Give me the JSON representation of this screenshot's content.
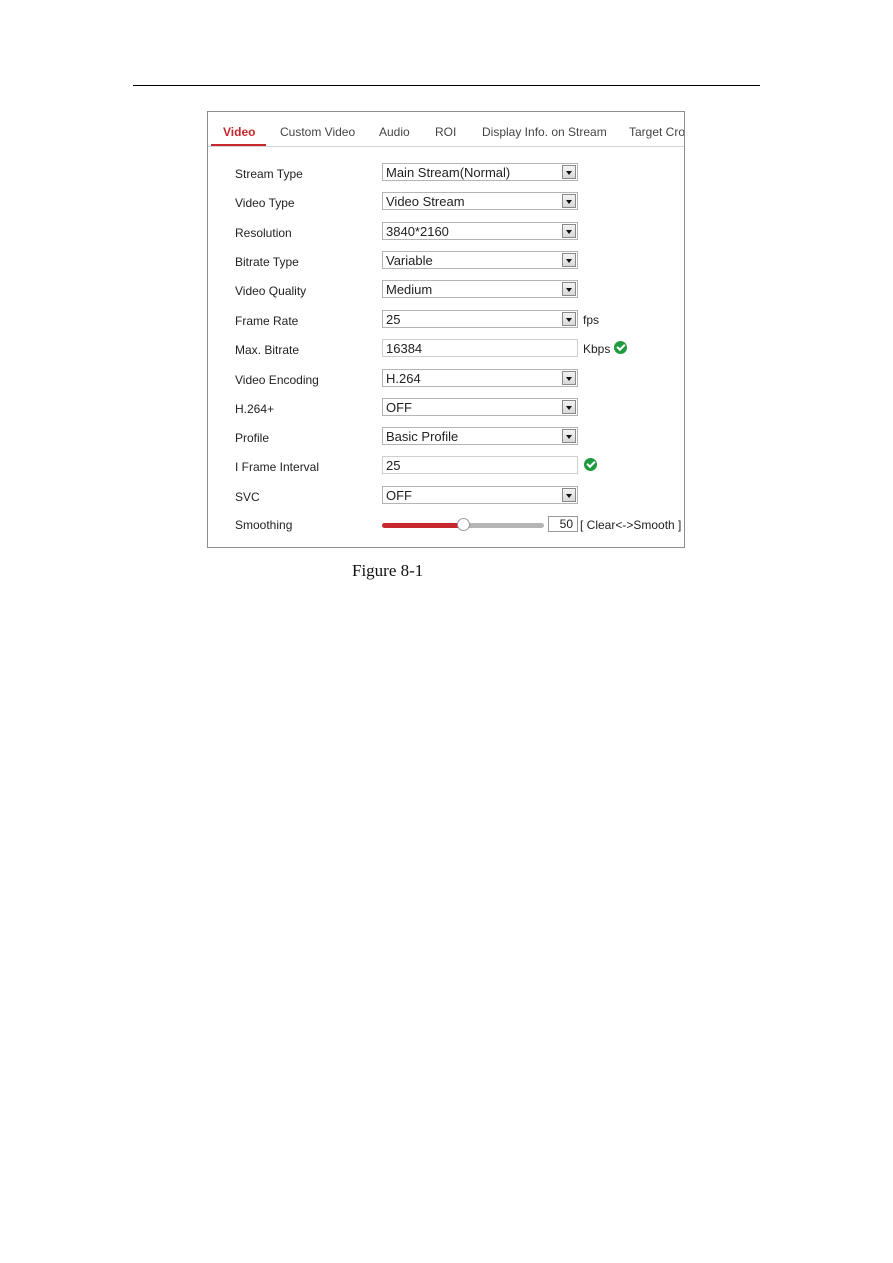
{
  "tabs": [
    {
      "label": "Video",
      "active": true
    },
    {
      "label": "Custom Video",
      "active": false
    },
    {
      "label": "Audio",
      "active": false
    },
    {
      "label": "ROI",
      "active": false
    },
    {
      "label": "Display Info. on Stream",
      "active": false
    },
    {
      "label": "Target Cro",
      "active": false
    }
  ],
  "form": {
    "stream_type": {
      "label": "Stream Type",
      "value": "Main Stream(Normal)"
    },
    "video_type": {
      "label": "Video Type",
      "value": "Video Stream"
    },
    "resolution": {
      "label": "Resolution",
      "value": "3840*2160"
    },
    "bitrate_type": {
      "label": "Bitrate Type",
      "value": "Variable"
    },
    "video_quality": {
      "label": "Video Quality",
      "value": "Medium"
    },
    "frame_rate": {
      "label": "Frame Rate",
      "value": "25",
      "unit": "fps"
    },
    "max_bitrate": {
      "label": "Max. Bitrate",
      "value": "16384",
      "unit": "Kbps",
      "valid": true
    },
    "video_encoding": {
      "label": "Video Encoding",
      "value": "H.264"
    },
    "h264_plus": {
      "label": "H.264+",
      "value": "OFF"
    },
    "profile": {
      "label": "Profile",
      "value": "Basic Profile"
    },
    "i_frame_interval": {
      "label": "I Frame Interval",
      "value": "25",
      "valid": true
    },
    "svc": {
      "label": "SVC",
      "value": "OFF"
    },
    "smoothing": {
      "label": "Smoothing",
      "value": "50",
      "percent": 50,
      "hint": "[ Clear<->Smooth ]"
    }
  },
  "colors": {
    "accent": "#c7282e",
    "valid": "#1e9b3f"
  },
  "caption": "Figure 8-1"
}
